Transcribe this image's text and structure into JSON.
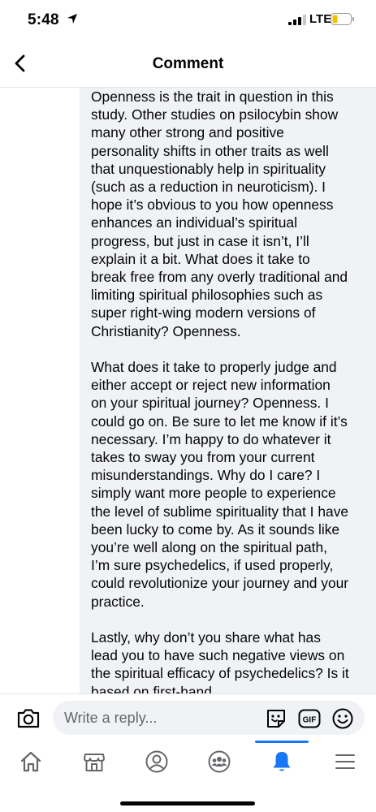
{
  "status_bar": {
    "time": "5:48",
    "network": "LTE"
  },
  "header": {
    "title": "Comment"
  },
  "comment": {
    "paragraphs": [
      "Openness is the trait in question in this study. Other studies on psilocybin show many other strong and positive personality shifts in other traits as well that unquestionably help in spirituality (such as a reduction in neuroticism). I hope it’s obvious to you how openness enhances an individual’s spiritual progress, but just in case it isn’t, I’ll explain it a bit. What does it take to break free from any overly traditional and limiting spiritual philosophies such as super right-wing modern versions of Christianity? Openness.",
      "What does it take to properly judge and either accept or reject new information on your spiritual journey? Openness. I could go on. Be sure to let me know if it’s necessary. I’m happy to do whatever it takes to sway you from your current misunderstandings. Why do I care? I simply want more people to experience the level of sublime spirituality that I have been lucky to come by. As it sounds like you’re well along on the spiritual path, I’m sure psychedelics, if used properly, could revolutionize your journey and your practice.",
      "Lastly, why don’t you share what has lead you to have such negative views on the spiritual efficacy of psychedelics? Is it based on first-hand"
    ]
  },
  "composer": {
    "placeholder": "Write a reply...",
    "gif_label": "GIF"
  },
  "tabbar": {
    "items": [
      {
        "icon": "home-icon",
        "active": false
      },
      {
        "icon": "marketplace-icon",
        "active": false
      },
      {
        "icon": "profile-icon",
        "active": false
      },
      {
        "icon": "groups-icon",
        "active": false
      },
      {
        "icon": "notifications-icon",
        "active": true
      },
      {
        "icon": "menu-icon",
        "active": false
      }
    ]
  },
  "colors": {
    "accent": "#1877f2",
    "bubble": "#f0f2f5",
    "icon": "#65676b"
  }
}
